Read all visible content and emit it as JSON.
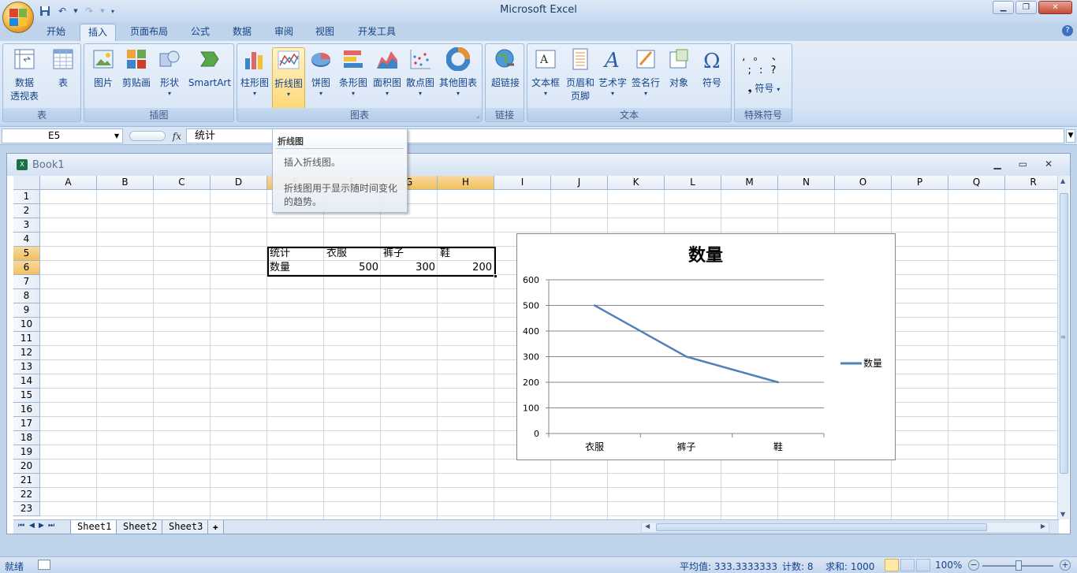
{
  "window": {
    "title": "Microsoft Excel"
  },
  "ribbon_tabs": [
    {
      "label": "开始"
    },
    {
      "label": "插入"
    },
    {
      "label": "页面布局"
    },
    {
      "label": "公式"
    },
    {
      "label": "数据"
    },
    {
      "label": "审阅"
    },
    {
      "label": "视图"
    },
    {
      "label": "开发工具"
    }
  ],
  "groups": {
    "tables": {
      "label": "表",
      "pivot": "数据\n透视表",
      "table": "表"
    },
    "illustrations": {
      "label": "插图",
      "picture": "图片",
      "clipart": "剪贴画",
      "shapes": "形状",
      "smartart": "SmartArt"
    },
    "charts": {
      "label": "图表",
      "column": "柱形图",
      "line": "折线图",
      "pie": "饼图",
      "bar": "条形图",
      "area": "面积图",
      "scatter": "散点图",
      "other": "其他图表"
    },
    "links": {
      "label": "链接",
      "hyperlink": "超链接"
    },
    "text": {
      "label": "文本",
      "textbox": "文本框",
      "header_footer": "页眉和\n页脚",
      "wordart": "艺术字",
      "signature": "签名行",
      "object": "对象",
      "symbol": "符号"
    },
    "special_symbols": {
      "label": "特殊符号",
      "symbol": "符号",
      "marks": ", 。 、 ; : ?"
    }
  },
  "formula_bar": {
    "name_box": "E5",
    "fx": "fx",
    "value": "统计"
  },
  "tooltip": {
    "title": "折线图",
    "line1": "插入折线图。",
    "line2": "折线图用于显示随时间变化的趋势。"
  },
  "workbook": {
    "name": "Book1"
  },
  "columns": [
    "A",
    "B",
    "C",
    "D",
    "E",
    "F",
    "G",
    "H",
    "I",
    "J",
    "K",
    "L",
    "M",
    "N",
    "O",
    "P",
    "Q",
    "R"
  ],
  "rows": [
    "1",
    "2",
    "3",
    "4",
    "5",
    "6",
    "7",
    "8",
    "9",
    "10",
    "11",
    "12",
    "13",
    "14",
    "15",
    "16",
    "17",
    "18",
    "19",
    "20",
    "21",
    "22",
    "23"
  ],
  "cells": {
    "E5": "统计",
    "F5": "衣服",
    "G5": "裤子",
    "H5": "鞋",
    "E6": "数量",
    "F6": "500",
    "G6": "300",
    "H6": "200"
  },
  "chart_data": {
    "type": "line",
    "title": "数量",
    "categories": [
      "衣服",
      "裤子",
      "鞋"
    ],
    "series": [
      {
        "name": "数量",
        "values": [
          500,
          300,
          200
        ],
        "color": "#4f81bd"
      }
    ],
    "ylim": [
      0,
      600
    ],
    "yticks": [
      "0",
      "100",
      "200",
      "300",
      "400",
      "500",
      "600"
    ],
    "grid": true,
    "legend": "right"
  },
  "sheets": [
    {
      "label": "Sheet1"
    },
    {
      "label": "Sheet2"
    },
    {
      "label": "Sheet3"
    }
  ],
  "status": {
    "ready": "就绪",
    "average": "平均值: 333.3333333",
    "count": "计数: 8",
    "sum": "求和: 1000",
    "zoom": "100%"
  }
}
